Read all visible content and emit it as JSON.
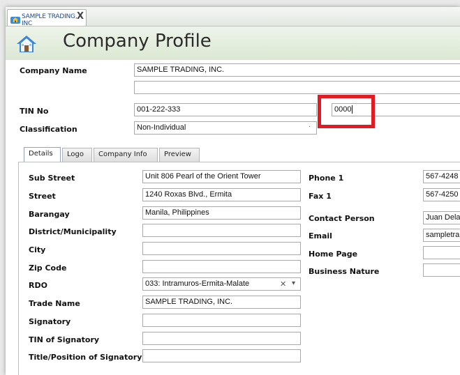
{
  "document_tab": {
    "label": "SAMPLE TRADING, INC",
    "close": "X"
  },
  "header": {
    "title": "Company Profile"
  },
  "company": {
    "name_label": "Company Name",
    "name_value": "SAMPLE TRADING, INC.",
    "name_line2": "",
    "tin_label": "TIN No",
    "tin_value": "001-222-333",
    "branch_value": "0000",
    "classification_label": "Classification",
    "classification_value": "Non-Individual"
  },
  "tabs": [
    {
      "label": "Details",
      "active": true
    },
    {
      "label": "Logo"
    },
    {
      "label": "Company Info"
    },
    {
      "label": "Preview"
    }
  ],
  "details": {
    "left": [
      {
        "label": "Sub Street",
        "value": "Unit 806 Pearl of the Orient Tower"
      },
      {
        "label": "Street",
        "value": "1240 Roxas Blvd., Ermita"
      },
      {
        "label": "Barangay",
        "value": "Manila, Philippines"
      },
      {
        "label": "District/Municipality",
        "value": ""
      },
      {
        "label": "City",
        "value": ""
      },
      {
        "label": "Zip Code",
        "value": ""
      },
      {
        "label": "RDO",
        "value": "033: Intramuros-Ermita-Malate"
      },
      {
        "label": "Trade Name",
        "value": "SAMPLE TRADING, INC."
      },
      {
        "label": "Signatory",
        "value": ""
      },
      {
        "label": "TIN of Signatory",
        "value": ""
      },
      {
        "label": "Title/Position of Signatory",
        "value": ""
      }
    ],
    "right": [
      {
        "label": "Phone 1",
        "value": "567-4248"
      },
      {
        "label": "Fax 1",
        "value": "567-4250"
      },
      {
        "label": "Contact Person",
        "value": "Juan Dela"
      },
      {
        "label": "Email",
        "value": "sampletra"
      },
      {
        "label": "Home Page",
        "value": ""
      },
      {
        "label": "Business Nature",
        "value": ""
      }
    ],
    "rdo_clear": "✕",
    "rdo_dropdown": "▾"
  },
  "icons": {
    "tab_icon": "company-icon",
    "header_icon": "house-icon"
  },
  "colors": {
    "highlight": "#e01b24",
    "header_bg": "#dbe8d3",
    "tab_text": "#1d4a8a"
  }
}
